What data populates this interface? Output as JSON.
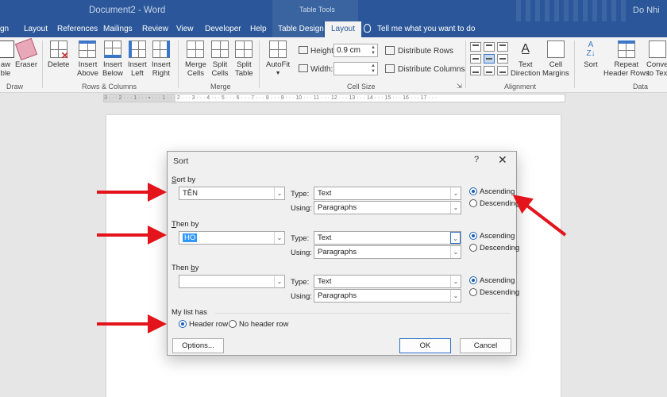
{
  "titlebar": {
    "doc_title": "Document2 - Word",
    "contextual_group": "Table Tools",
    "user": "Do Nhi"
  },
  "tabs": [
    "gn",
    "Layout",
    "References",
    "Mailings",
    "Review",
    "View",
    "Developer",
    "Help",
    "Table Design",
    "Layout"
  ],
  "tell_me": "Tell me what you want to do",
  "ribbon": {
    "draw": {
      "draw_label": "aw",
      "draw_label2": "ble",
      "eraser": "Eraser",
      "group": "Draw"
    },
    "rows_columns": {
      "delete": "Delete",
      "insert_above": [
        "Insert",
        "Above"
      ],
      "insert_below": [
        "Insert",
        "Below"
      ],
      "insert_left": [
        "Insert",
        "Left"
      ],
      "insert_right": [
        "Insert",
        "Right"
      ],
      "group": "Rows & Columns"
    },
    "merge": {
      "merge_cells": [
        "Merge",
        "Cells"
      ],
      "split_cells": [
        "Split",
        "Cells"
      ],
      "split_table": [
        "Split",
        "Table"
      ],
      "group": "Merge"
    },
    "cell_size": {
      "autofit": "AutoFit",
      "height_label": "Height:",
      "height_value": "0.9 cm",
      "width_label": "Width:",
      "width_value": "",
      "distribute_rows": "Distribute Rows",
      "distribute_columns": "Distribute Columns",
      "group": "Cell Size"
    },
    "alignment": {
      "text_direction": [
        "Text",
        "Direction"
      ],
      "cell_margins": [
        "Cell",
        "Margins"
      ],
      "group": "Alignment"
    },
    "data": {
      "sort": "Sort",
      "repeat_header": [
        "Repeat",
        "Header Rows"
      ],
      "convert": [
        "Conve",
        "to Tex"
      ],
      "group": "Data"
    }
  },
  "ruler_text": "3 · · · 2 · · · 1 · · · ▪ · · · 1 · · · 2 · · · 3 · · · 4 · · · 5 · · · 6 · · · 7 · · · 8 · · · 9 · · · 10 · · · 11 · · · 12 · · · 13 · · · 14 · · · 15 · · · 16 · · · 17 · · ·",
  "dialog": {
    "title": "Sort",
    "help": "?",
    "close": "✕",
    "sort_by": {
      "label_pre": "",
      "label_key": "S",
      "label_post": "ort by",
      "value": "TÊN",
      "type_label": "Type:",
      "type_value": "Text",
      "using_label": "Using:",
      "using_value": "Paragraphs",
      "ascending": "Ascending",
      "descending": "Descending"
    },
    "then_by_1": {
      "label_pre": "",
      "label_key": "T",
      "label_post": "hen by",
      "value": "HO",
      "type_label": "Type:",
      "type_value": "Text",
      "using_label": "Using:",
      "using_value": "Paragraphs",
      "ascending": "Ascending",
      "descending": "Descending"
    },
    "then_by_2": {
      "label_pre": "Then ",
      "label_key": "b",
      "label_post": "y",
      "value": "",
      "type_label": "Type:",
      "type_value": "Text",
      "using_label": "Using:",
      "using_value": "Paragraphs",
      "ascending": "Ascending",
      "descending": "Descending"
    },
    "my_list_has": "My list has",
    "header_row": "Header row",
    "no_header_row": "No header row",
    "options": "Options...",
    "ok": "OK",
    "cancel": "Cancel"
  },
  "colors": {
    "word_blue": "#2b579a",
    "arrow_red": "#e3141b",
    "selection": "#3399ff"
  }
}
